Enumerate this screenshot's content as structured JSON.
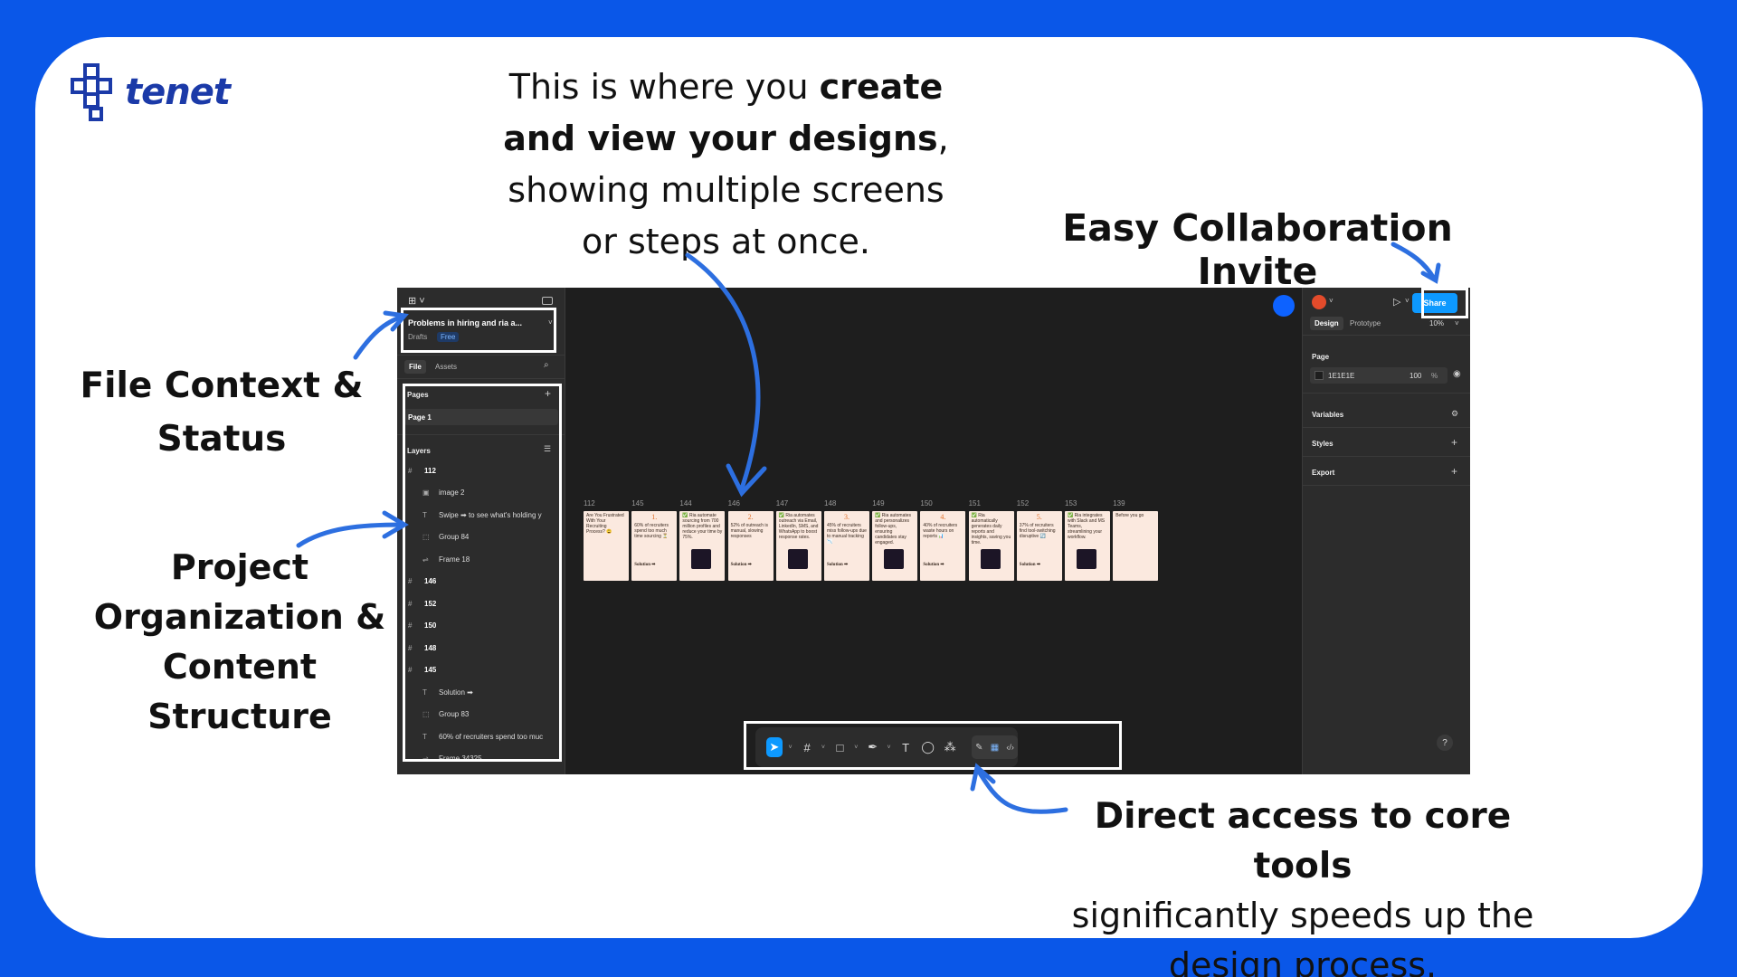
{
  "brand": {
    "logo_text": "tenet"
  },
  "annotations": {
    "top_line1_prefix": "This is where you ",
    "top_line1_bold": "create",
    "top_line2_bold": "and view your designs",
    "top_line2_suffix": ",",
    "top_line3": "showing multiple screens",
    "top_line4": "or steps at once.",
    "collab": "Easy Collaboration Invite",
    "file_line1": "File Context &",
    "file_line2": "Status",
    "proj_line1": "Project",
    "proj_line2": "Organization &",
    "proj_line3": "Content",
    "proj_line4": "Structure",
    "tools_bold": "Direct access to core tools",
    "tools_line2": "significantly speeds up the",
    "tools_line3": "design process."
  },
  "app": {
    "file": {
      "title": "Problems in hiring and ria a...",
      "location": "Drafts",
      "plan_badge": "Free"
    },
    "left_tabs": [
      "File",
      "Assets"
    ],
    "pages_header": "Pages",
    "pages": [
      "Page 1"
    ],
    "layers_header": "Layers",
    "layers": [
      {
        "name": "112",
        "type": "frame",
        "indent": 0
      },
      {
        "name": "image 2",
        "type": "image",
        "indent": 1
      },
      {
        "name": "Swipe ➡ to see what's holding y",
        "type": "text",
        "indent": 1
      },
      {
        "name": "Group 84",
        "type": "group",
        "indent": 1
      },
      {
        "name": "Frame 18",
        "type": "autolayout",
        "indent": 1
      },
      {
        "name": "146",
        "type": "frame",
        "indent": 0
      },
      {
        "name": "152",
        "type": "frame",
        "indent": 0
      },
      {
        "name": "150",
        "type": "frame",
        "indent": 0
      },
      {
        "name": "148",
        "type": "frame",
        "indent": 0
      },
      {
        "name": "145",
        "type": "frame",
        "indent": 0
      },
      {
        "name": "Solution ➡",
        "type": "text",
        "indent": 1
      },
      {
        "name": "Group 83",
        "type": "group",
        "indent": 1
      },
      {
        "name": "60% of recruiters spend too muc",
        "type": "text",
        "indent": 1
      },
      {
        "name": "Frame 34325",
        "type": "autolayout",
        "indent": 1
      }
    ],
    "right": {
      "share_label": "Share",
      "tabs": [
        "Design",
        "Prototype"
      ],
      "zoom": "10%",
      "page_section": "Page",
      "page_color": "1E1E1E",
      "page_opacity": "100",
      "percent_sign": "%",
      "sections": [
        "Variables",
        "Styles",
        "Export"
      ],
      "help": "?"
    },
    "frames": [
      {
        "label": "112",
        "headline": "Are You Frustrated With Your Recruiting Process? 😩",
        "accent": "",
        "footer": ""
      },
      {
        "label": "145",
        "headline": "60% of recruiters spend too much time sourcing ⏳",
        "accent": "1.",
        "footer": "Solution ➡"
      },
      {
        "label": "144",
        "headline": "✅ Ria automate sourcing from 700 million profiles and reduce your time by 75%.",
        "accent": "",
        "footer": ""
      },
      {
        "label": "146",
        "headline": "52% of outreach is manual, slowing responses",
        "accent": "2.",
        "footer": "Solution ➡"
      },
      {
        "label": "147",
        "headline": "✅ Ria automates outreach via Email, LinkedIn, SMS, and WhatsApp to boost response rates.",
        "accent": "",
        "footer": ""
      },
      {
        "label": "148",
        "headline": "45% of recruiters miss follow-ups due to manual tracking 📉",
        "accent": "3.",
        "footer": "Solution ➡"
      },
      {
        "label": "149",
        "headline": "✅ Ria automates and personalizes follow-ups, ensuring candidates stay engaged.",
        "accent": "",
        "footer": ""
      },
      {
        "label": "150",
        "headline": "40% of recruiters waste hours on reports 📊",
        "accent": "4.",
        "footer": "Solution ➡"
      },
      {
        "label": "151",
        "headline": "✅ Ria automatically generates daily reports and insights, saving you time.",
        "accent": "",
        "footer": ""
      },
      {
        "label": "152",
        "headline": "37% of recruiters find tool-switching disruptive 🔄",
        "accent": "5.",
        "footer": "Solution ➡"
      },
      {
        "label": "153",
        "headline": "✅ Ria integrates with Slack and MS Teams, streamlining your workflow.",
        "accent": "",
        "footer": ""
      },
      {
        "label": "139",
        "headline": "Before you go",
        "accent": "",
        "footer": ""
      }
    ],
    "toolbar": [
      "move-tool",
      "frame-tool",
      "shape-tool",
      "pen-tool",
      "text-tool",
      "comment-tool",
      "actions-tool",
      "draw-mode",
      "design-mode",
      "dev-mode"
    ],
    "text_tool_glyph": "T"
  },
  "colors": {
    "background_blue": "#0a57e8",
    "figma_blue": "#0d99ff",
    "highlight": "#ffffff"
  }
}
